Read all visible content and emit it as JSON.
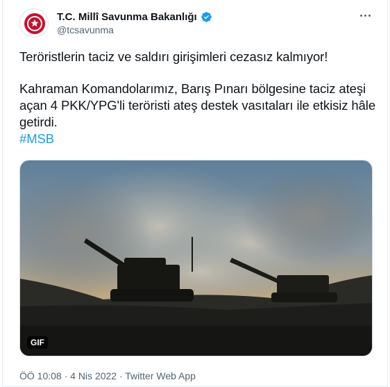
{
  "tweet": {
    "display_name": "T.C. Millî Savunma Bakanlığı",
    "handle": "@tcsavunma",
    "text_line_1": "Teröristlerin taciz ve saldırı girişimleri cezasız kalmıyor!",
    "text_paragraph_2": "Kahraman Komandolarımız, Barış Pınarı bölgesine taciz ateşi açan 4 PKK/YPG'li teröristi ateş destek vasıtaları ile etkisiz hâle getirdi.",
    "hashtag": "#MSB",
    "media_badge": "GIF",
    "timestamp": "ÖÖ 10:08 · 4 Nis 2022 · Twitter Web App"
  },
  "colors": {
    "link": "#1d9bf0",
    "verified": "#1d9bf0",
    "secondary_text": "#536471"
  },
  "icons": {
    "verified": "verified-badge-icon",
    "more": "more-options-icon",
    "avatar": "msb-emblem-avatar"
  }
}
